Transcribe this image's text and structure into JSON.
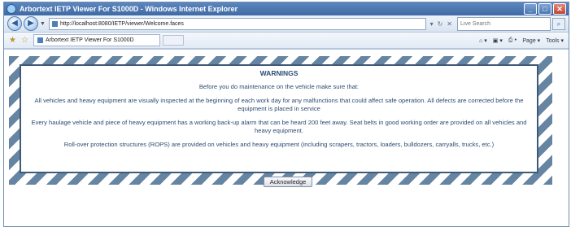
{
  "window": {
    "title": "Arbortext IETP Viewer For S1000D - Windows Internet Explorer",
    "min_glyph": "_",
    "max_glyph": "□",
    "close_glyph": "✕"
  },
  "address_bar": {
    "back_glyph": "◀",
    "forward_glyph": "▶",
    "dropdown_glyph": "▼",
    "url": "http://localhost:8080/IETP/viewer/Welcome.faces",
    "go_glyph": "▾",
    "refresh_glyph": "↻",
    "stop_glyph": "✕",
    "search_placeholder": "Live Search",
    "search_glyph": "⌕"
  },
  "tabs": {
    "favorites_glyph": "★",
    "add_favorites_glyph": "☆",
    "active_tab": "Arbortext IETP Viewer For S1000D",
    "commands": {
      "home": "⌂ ▾",
      "feeds": "▣ ▾",
      "print": "⎙ ▾",
      "page": "Page ▾",
      "tools": "Tools ▾"
    }
  },
  "warnings": {
    "heading": "WARNINGS",
    "intro": "Before you do maintenance on the vehicle make sure that:",
    "item1": "All vehicles and heavy equipment are visually inspected at the beginning of each work day for any malfunctions that could affect safe operation. All defects are corrected before the equipment is placed in service",
    "item2": "Every haulage vehicle and piece of heavy equipment has a working back-up alarm that can be heard 200 feet away. Seat belts in good working order are provided on all vehicles and heavy equipment.",
    "item3": "Roll-over protection structures (ROPS) are provided on vehicles and heavy equipment (including scrapers, tractors, loaders, bulldozers, carryalls, trucks, etc.)"
  },
  "acknowledge_label": "Acknowledge"
}
